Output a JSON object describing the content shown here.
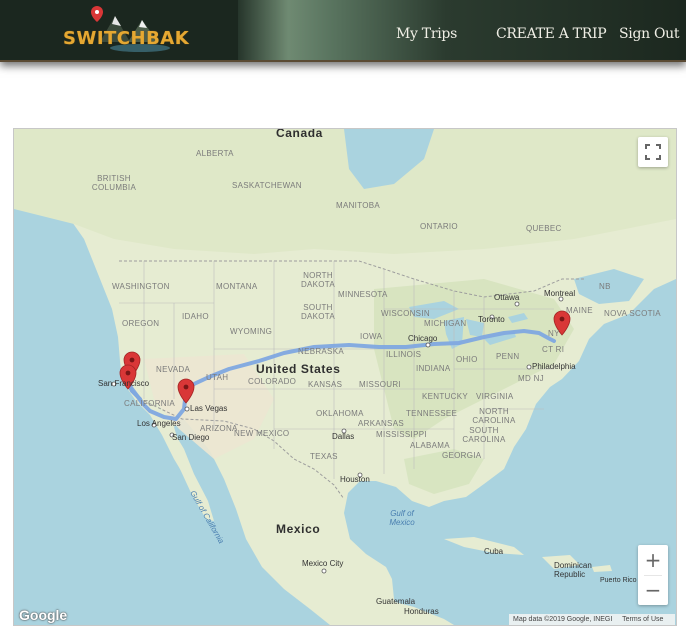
{
  "header": {
    "logo_text": "SWITCHBAK",
    "nav": {
      "my_trips": "My Trips",
      "create_trip": "CREATE A TRIP",
      "sign_out": "Sign Out"
    },
    "accent_color": "#e5a832"
  },
  "map": {
    "labels": {
      "countries": {
        "canada": "Canada",
        "united_states": "United States",
        "mexico": "Mexico"
      },
      "regions": {
        "alberta": "ALBERTA",
        "british_columbia": "BRITISH COLUMBIA",
        "saskatchewan": "SASKATCHEWAN",
        "manitoba": "MANITOBA",
        "ontario": "ONTARIO",
        "quebec": "QUEBEC",
        "nb": "NB",
        "nova_scotia": "NOVA SCOTIA",
        "washington": "WASHINGTON",
        "montana": "MONTANA",
        "north_dakota": "NORTH DAKOTA",
        "minnesota": "MINNESOTA",
        "oregon": "OREGON",
        "idaho": "IDAHO",
        "wyoming": "WYOMING",
        "south_dakota": "SOUTH DAKOTA",
        "wisconsin": "WISCONSIN",
        "michigan": "MICHIGAN",
        "iowa": "IOWA",
        "nebraska": "NEBRASKA",
        "nevada": "NEVADA",
        "utah": "UTAH",
        "colorado": "COLORADO",
        "kansas": "KANSAS",
        "missouri": "MISSOURI",
        "illinois": "ILLINOIS",
        "indiana": "INDIANA",
        "ohio": "OHIO",
        "penn": "PENN",
        "california": "CALIFORNIA",
        "arizona": "ARIZONA",
        "new_mexico": "NEW MEXICO",
        "oklahoma": "OKLAHOMA",
        "arkansas": "ARKANSAS",
        "tennessee": "TENNESSEE",
        "kentucky": "KENTUCKY",
        "virginia": "VIRGINIA",
        "north_carolina": "NORTH CAROLINA",
        "south_carolina": "SOUTH CAROLINA",
        "mississippi": "MISSISSIPPI",
        "alabama": "ALABAMA",
        "georgia": "GEORGIA",
        "texas": "TEXAS",
        "maine": "MAINE",
        "md_nj": "MD NJ",
        "ct_ri": "CT RI",
        "ny": "NY"
      },
      "cities": {
        "ottawa": "Ottawa",
        "montreal": "Montreal",
        "toronto": "Toronto",
        "chicago": "Chicago",
        "philadelphia": "Philadelphia",
        "san_francisco": "San Francisco",
        "las_vegas": "Las Vegas",
        "los_angeles": "Los Angeles",
        "san_diego": "San Diego",
        "dallas": "Dallas",
        "houston": "Houston",
        "mexico_city": "Mexico City",
        "guatemala": "Guatemala",
        "honduras": "Honduras",
        "cuba": "Cuba",
        "dominican_republic": "Dominican Republic",
        "puerto_rico": "Puerto Rico"
      },
      "water": {
        "gulf_of_mexico": "Gulf of Mexico",
        "gulf_of_california": "Gulf of California"
      }
    },
    "controls": {
      "zoom_in": "+",
      "zoom_out": "−"
    },
    "google_logo": "Google",
    "attribution": {
      "map_data": "Map data ©2019 Google, INEGI",
      "terms": "Terms of Use"
    },
    "colors": {
      "land": "#e8eed7",
      "water": "#aad3df",
      "route": "#7fa8e0",
      "marker": "#d93737"
    }
  }
}
